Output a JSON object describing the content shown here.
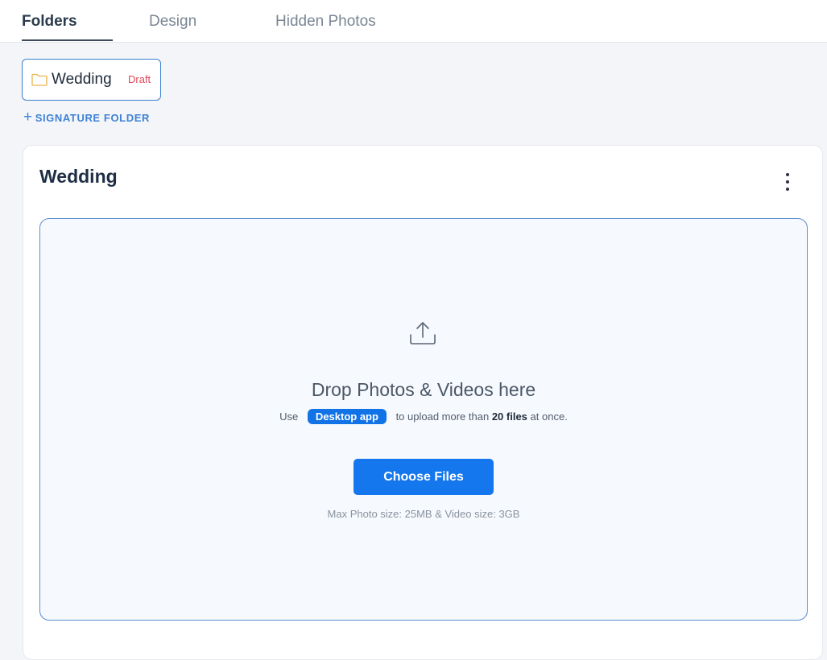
{
  "nav": {
    "tabs": [
      {
        "label": "Folders",
        "active": true
      },
      {
        "label": "Design",
        "active": false
      },
      {
        "label": "Hidden Photos",
        "active": false
      }
    ]
  },
  "folders": {
    "items": [
      {
        "name": "Wedding",
        "status": "Draft",
        "icon": "folder-icon"
      }
    ],
    "add_label": "SIGNATURE FOLDER",
    "add_icon": "plus-icon"
  },
  "panel": {
    "title": "Wedding",
    "menu_icon": "kebab-menu-icon"
  },
  "dropzone": {
    "icon": "upload-icon",
    "title": "Drop Photos & Videos here",
    "sub_prefix": "Use",
    "desktop_app_label": "Desktop app",
    "sub_middle": "to upload more than",
    "sub_bold": "20 files",
    "sub_suffix": "at once.",
    "button_label": "Choose Files",
    "limits": "Max Photo size: 25MB & Video size: 3GB"
  },
  "colors": {
    "accent": "#1477ee",
    "draft": "#e0485a",
    "link": "#3e82d6",
    "folder_icon": "#e9b44c"
  }
}
